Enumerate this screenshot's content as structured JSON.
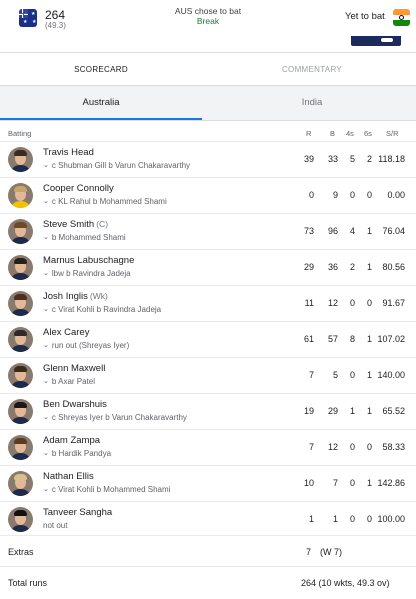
{
  "match": {
    "team_score": "264",
    "team_overs": "(49.3)",
    "toss": "AUS chose to bat",
    "status": "Break",
    "other_status": "Yet to bat"
  },
  "tabs": {
    "scorecard": "SCORECARD",
    "commentary": "COMMENTARY"
  },
  "teams": {
    "first": "Australia",
    "second": "India"
  },
  "columns": {
    "batting": "Batting",
    "r": "R",
    "b": "B",
    "fours": "4s",
    "sixes": "6s",
    "sr": "S/R"
  },
  "batters": [
    {
      "name": "Travis Head",
      "role": "",
      "dismissal": "c Shubman Gill b Varun Chakaravarthy",
      "has_chevron": true,
      "r": "39",
      "b": "33",
      "fours": "5",
      "sixes": "2",
      "sr": "118.18"
    },
    {
      "name": "Cooper Connolly",
      "role": "",
      "dismissal": "c KL Rahul b Mohammed Shami",
      "has_chevron": true,
      "r": "0",
      "b": "9",
      "fours": "0",
      "sixes": "0",
      "sr": "0.00"
    },
    {
      "name": "Steve Smith",
      "role": "(C)",
      "dismissal": "b Mohammed Shami",
      "has_chevron": true,
      "r": "73",
      "b": "96",
      "fours": "4",
      "sixes": "1",
      "sr": "76.04"
    },
    {
      "name": "Marnus Labuschagne",
      "role": "",
      "dismissal": "lbw b Ravindra Jadeja",
      "has_chevron": true,
      "r": "29",
      "b": "36",
      "fours": "2",
      "sixes": "1",
      "sr": "80.56"
    },
    {
      "name": "Josh Inglis",
      "role": "(Wk)",
      "dismissal": "c Virat Kohli b Ravindra Jadeja",
      "has_chevron": true,
      "r": "11",
      "b": "12",
      "fours": "0",
      "sixes": "0",
      "sr": "91.67"
    },
    {
      "name": "Alex Carey",
      "role": "",
      "dismissal": "run out (Shreyas Iyer)",
      "has_chevron": true,
      "r": "61",
      "b": "57",
      "fours": "8",
      "sixes": "1",
      "sr": "107.02"
    },
    {
      "name": "Glenn Maxwell",
      "role": "",
      "dismissal": "b Axar Patel",
      "has_chevron": true,
      "r": "7",
      "b": "5",
      "fours": "0",
      "sixes": "1",
      "sr": "140.00"
    },
    {
      "name": "Ben Dwarshuis",
      "role": "",
      "dismissal": "c Shreyas Iyer b Varun Chakaravarthy",
      "has_chevron": true,
      "r": "19",
      "b": "29",
      "fours": "1",
      "sixes": "1",
      "sr": "65.52"
    },
    {
      "name": "Adam Zampa",
      "role": "",
      "dismissal": "b Hardik Pandya",
      "has_chevron": true,
      "r": "7",
      "b": "12",
      "fours": "0",
      "sixes": "0",
      "sr": "58.33"
    },
    {
      "name": "Nathan Ellis",
      "role": "",
      "dismissal": "c Virat Kohli b Mohammed Shami",
      "has_chevron": true,
      "r": "10",
      "b": "7",
      "fours": "0",
      "sixes": "1",
      "sr": "142.86"
    },
    {
      "name": "Tanveer Sangha",
      "role": "",
      "dismissal": "not out",
      "has_chevron": false,
      "r": "1",
      "b": "1",
      "fours": "0",
      "sixes": "0",
      "sr": "100.00"
    }
  ],
  "extras": {
    "label": "Extras",
    "value": "7",
    "detail": "(W 7)"
  },
  "total": {
    "label": "Total runs",
    "value": "264 (10 wkts, 49.3 ov)"
  },
  "colors": {
    "accent": "#1a73e8",
    "status": "#188038"
  }
}
